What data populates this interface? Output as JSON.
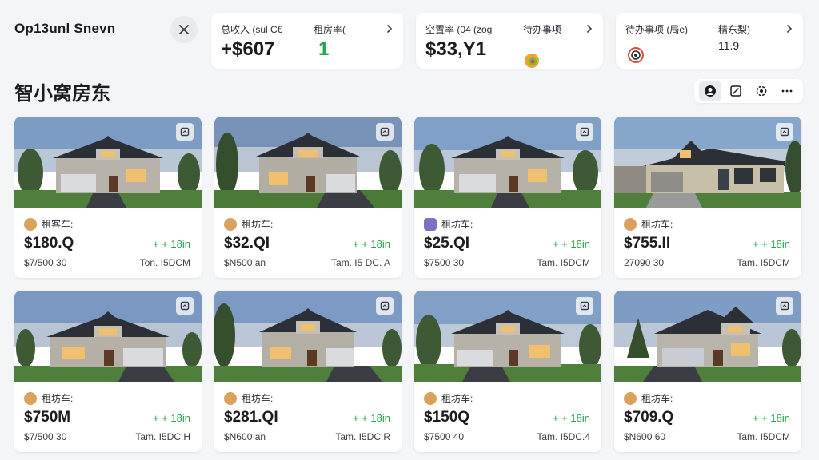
{
  "header": {
    "app_title": "Op13unl Snevn",
    "close_icon": "close-icon"
  },
  "stats": [
    {
      "label": "总收入 (sul C€",
      "value": "+$607",
      "extra": "1"
    },
    {
      "label": "空置率 (04 (zog",
      "value": "$33,Y1"
    },
    {
      "label": "待办事项",
      "icon": "fire-icon"
    },
    {
      "label": "待办事项 (局e)",
      "icon": "alert-icon"
    },
    {
      "label": "精东梨)",
      "value": "11.9"
    }
  ],
  "section": {
    "title": "智小窝房东"
  },
  "toolbar": {
    "buttons": [
      "user-icon",
      "edit-icon",
      "settings-icon",
      "more-icon"
    ]
  },
  "properties": [
    {
      "owner": "租客车:",
      "price": "$180.Q",
      "change": "+ + 18in",
      "meta_left": "$7/500 30",
      "meta_right": "Ton. I5DCM"
    },
    {
      "owner": "租坊车:",
      "price": "$32.QI",
      "change": "+ + 18in",
      "meta_left": "$N500 an",
      "meta_right": "Tam. I5 DC. A"
    },
    {
      "owner": "租坊车:",
      "price": "$25.QI",
      "change": "+ + 18in",
      "meta_left": "$7500 30",
      "meta_right": "Tam. I5DCM"
    },
    {
      "owner": "租坊车:",
      "price": "$755.II",
      "change": "+ + 18in",
      "meta_left": "27090 30",
      "meta_right": "Tam. I5DCM"
    },
    {
      "owner": "租坊车:",
      "price": "$750M",
      "change": "+ + 18in",
      "meta_left": "$7/500 30",
      "meta_right": "Tam. I5DC.H"
    },
    {
      "owner": "租坊车:",
      "price": "$281.QI",
      "change": "+ + 18in",
      "meta_left": "$N600 an",
      "meta_right": "Tam. I5DC.R"
    },
    {
      "owner": "租坊车:",
      "price": "$150Q",
      "change": "+ + 18in",
      "meta_left": "$7500 40",
      "meta_right": "Tam. I5DC.4"
    },
    {
      "owner": "租坊车:",
      "price": "$709.Q",
      "change": "+ + 18in",
      "meta_left": "$N600 60",
      "meta_right": "Tam. I5DCM"
    }
  ],
  "colors": {
    "accent_green": "#27a34a",
    "background": "#f4f5f7",
    "card": "#ffffff"
  }
}
